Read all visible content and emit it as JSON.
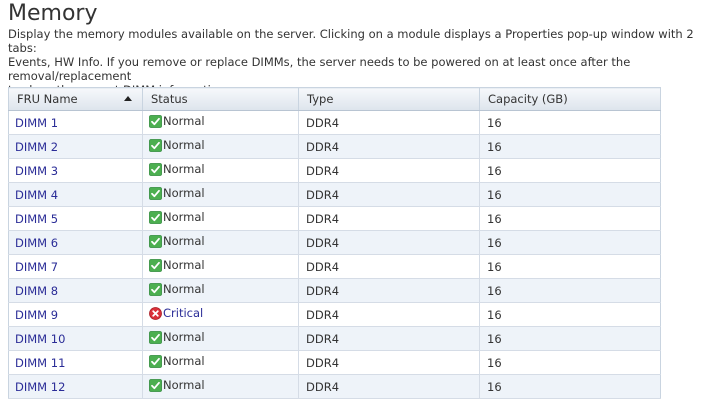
{
  "page": {
    "title": "Memory",
    "description_line1": "Display the memory modules available on the server. Clicking on a module displays a Properties pop-up window with 2 tabs:",
    "description_line2": "Events, HW Info. If you remove or replace DIMMs, the server needs to be powered on at least once after the removal/replacement",
    "description_line3": "to show the correct DIMM information."
  },
  "table": {
    "columns": [
      "FRU Name",
      "Status",
      "Type",
      "Capacity (GB)"
    ],
    "sort": {
      "column": "FRU Name",
      "direction": "ascending",
      "icon": "sort-ascending-icon"
    },
    "status_icons": {
      "Normal": "check-icon",
      "Critical": "error-icon"
    },
    "colors": {
      "normal_icon": "#4caf50",
      "critical_icon": "#d9303a",
      "link": "#2a2c97"
    },
    "rows": [
      {
        "name": "DIMM 1",
        "status": "Normal",
        "type": "DDR4",
        "capacity": "16"
      },
      {
        "name": "DIMM 2",
        "status": "Normal",
        "type": "DDR4",
        "capacity": "16"
      },
      {
        "name": "DIMM 3",
        "status": "Normal",
        "type": "DDR4",
        "capacity": "16"
      },
      {
        "name": "DIMM 4",
        "status": "Normal",
        "type": "DDR4",
        "capacity": "16"
      },
      {
        "name": "DIMM 5",
        "status": "Normal",
        "type": "DDR4",
        "capacity": "16"
      },
      {
        "name": "DIMM 6",
        "status": "Normal",
        "type": "DDR4",
        "capacity": "16"
      },
      {
        "name": "DIMM 7",
        "status": "Normal",
        "type": "DDR4",
        "capacity": "16"
      },
      {
        "name": "DIMM 8",
        "status": "Normal",
        "type": "DDR4",
        "capacity": "16"
      },
      {
        "name": "DIMM 9",
        "status": "Critical",
        "type": "DDR4",
        "capacity": "16"
      },
      {
        "name": "DIMM 10",
        "status": "Normal",
        "type": "DDR4",
        "capacity": "16"
      },
      {
        "name": "DIMM 11",
        "status": "Normal",
        "type": "DDR4",
        "capacity": "16"
      },
      {
        "name": "DIMM 12",
        "status": "Normal",
        "type": "DDR4",
        "capacity": "16"
      }
    ]
  }
}
